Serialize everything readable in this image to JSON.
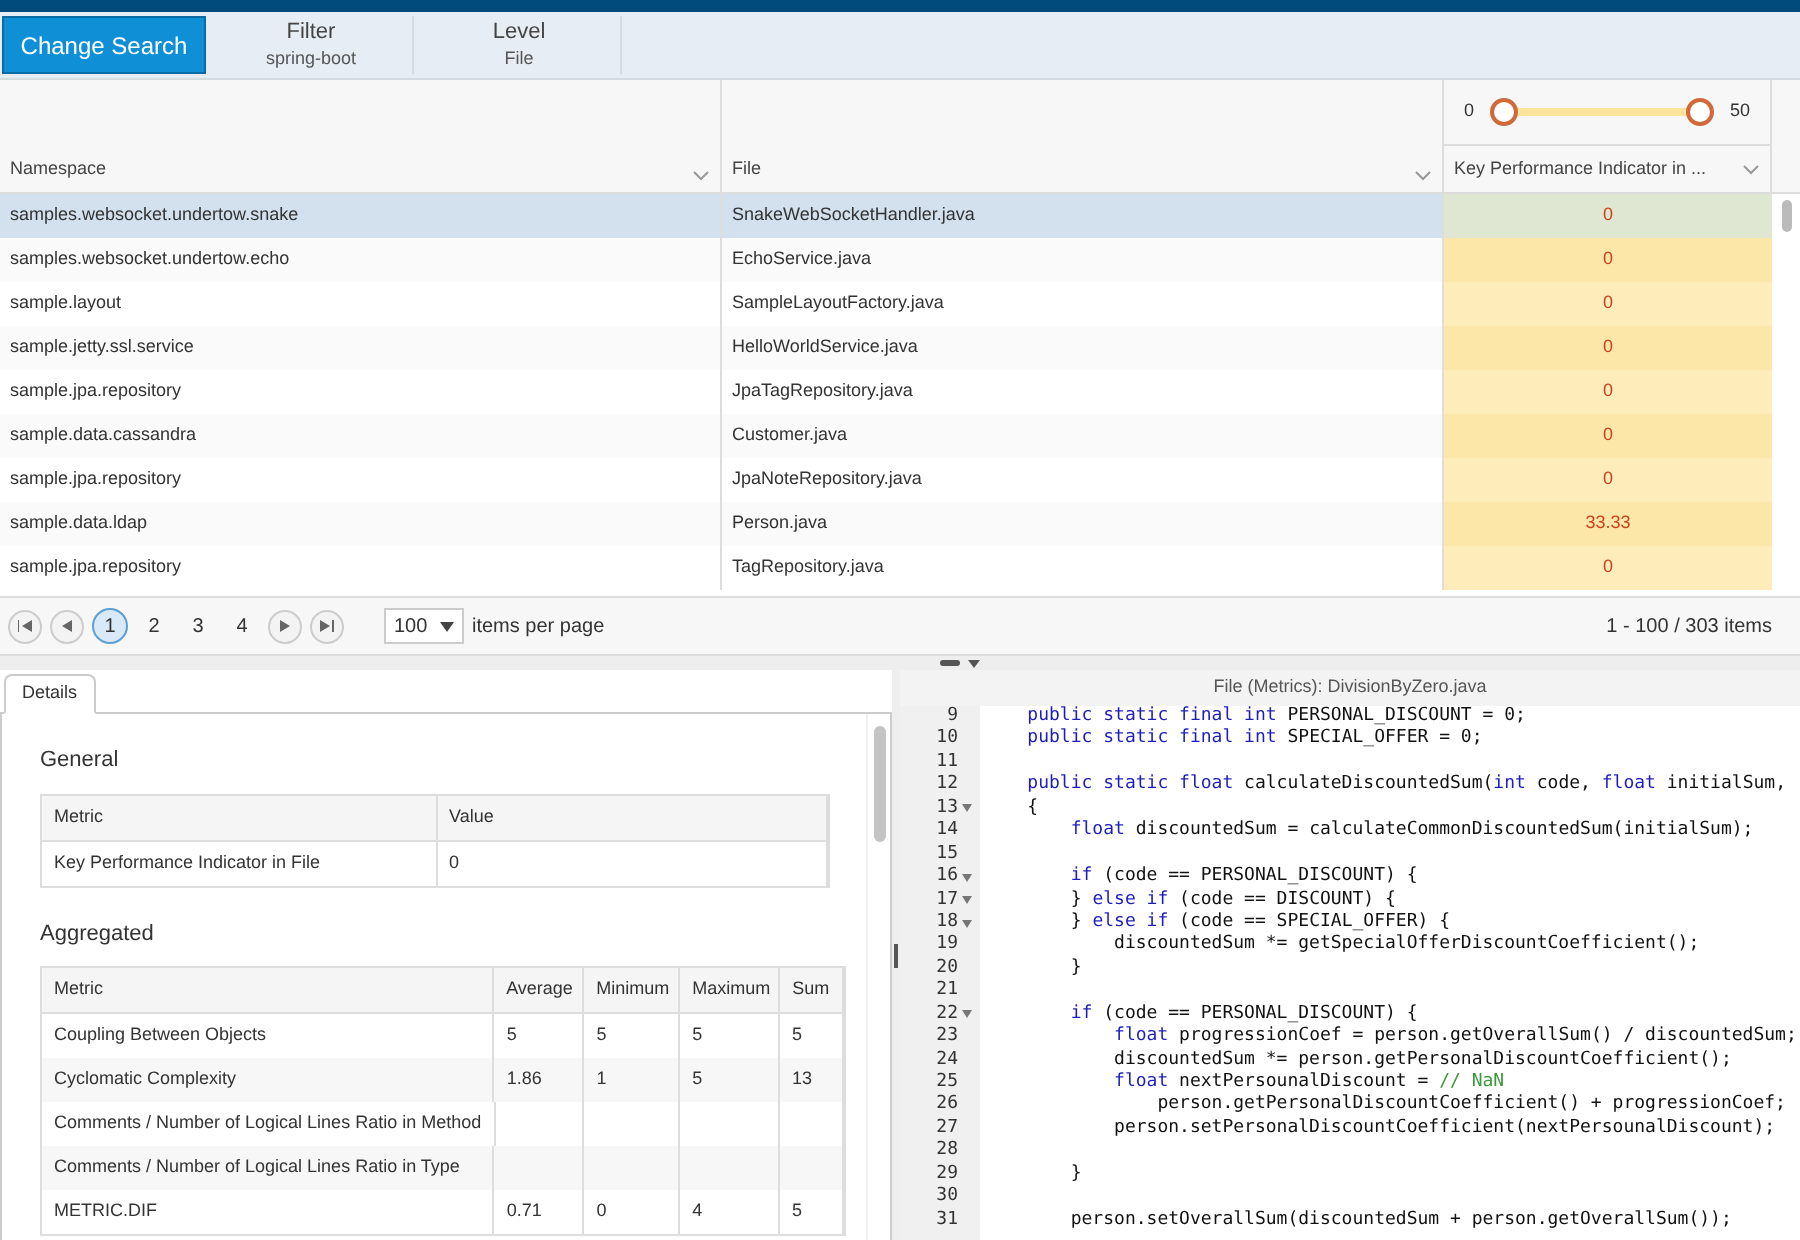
{
  "toolbar": {
    "button": "Change Search",
    "items": [
      {
        "label": "Filter",
        "value": "spring-boot"
      },
      {
        "label": "Level",
        "value": "File"
      }
    ]
  },
  "grid": {
    "columns": [
      "Namespace",
      "File",
      "Key Performance Indicator in ..."
    ],
    "range_slider": {
      "min_label": "0",
      "max_label": "50",
      "level": 1
    },
    "rows": [
      {
        "namespace": "samples.websocket.undertow.snake",
        "file": "SnakeWebSocketHandler.java",
        "kpi": "0",
        "selected": true
      },
      {
        "namespace": "samples.websocket.undertow.echo",
        "file": "EchoService.java",
        "kpi": "0",
        "selected": false
      },
      {
        "namespace": "sample.layout",
        "file": "SampleLayoutFactory.java",
        "kpi": "0",
        "selected": false
      },
      {
        "namespace": "sample.jetty.ssl.service",
        "file": "HelloWorldService.java",
        "kpi": "0",
        "selected": false
      },
      {
        "namespace": "sample.jpa.repository",
        "file": "JpaTagRepository.java",
        "kpi": "0",
        "selected": false
      },
      {
        "namespace": "sample.data.cassandra",
        "file": "Customer.java",
        "kpi": "0",
        "selected": false
      },
      {
        "namespace": "sample.jpa.repository",
        "file": "JpaNoteRepository.java",
        "kpi": "0",
        "selected": false
      },
      {
        "namespace": "sample.data.ldap",
        "file": "Person.java",
        "kpi": "33.33",
        "selected": false
      },
      {
        "namespace": "sample.jpa.repository",
        "file": "TagRepository.java",
        "kpi": "0",
        "selected": false
      }
    ]
  },
  "pager": {
    "pages": [
      {
        "label": "1",
        "selected": true
      },
      {
        "label": "2",
        "selected": false
      },
      {
        "label": "3",
        "selected": false
      },
      {
        "label": "4",
        "selected": false
      }
    ],
    "page_size": "100",
    "page_size_label": "items per page",
    "summary": "1 - 100 / 303 items"
  },
  "details": {
    "tabs": [
      {
        "label": "Details",
        "selected": true
      }
    ],
    "general": {
      "title": "General",
      "columns": [
        "Metric",
        "Value"
      ],
      "rows": [
        [
          "Key Performance Indicator in File",
          "0"
        ]
      ]
    },
    "aggregated": {
      "title": "Aggregated",
      "columns": [
        "Metric",
        "Average",
        "Minimum",
        "Maximum",
        "Sum"
      ],
      "rows": [
        [
          "Coupling Between Objects",
          "5",
          "5",
          "5",
          "5"
        ],
        [
          "Cyclomatic Complexity",
          "1.86",
          "1",
          "5",
          "13"
        ],
        [
          "Comments / Number of Logical Lines Ratio in Method",
          null,
          null,
          null,
          null
        ],
        [
          "Comments / Number of Logical Lines Ratio in Type",
          null,
          null,
          null,
          null
        ],
        [
          "METRIC.DIF",
          "0.71",
          "0",
          "4",
          "5"
        ]
      ]
    }
  },
  "editor": {
    "title": "File (Metrics): DivisionByZero.java",
    "lines": [
      {
        "number": "9",
        "fold": false,
        "tokens": [
          {
            "kind": "keyword",
            "text": "    public static final int"
          },
          {
            "kind": "plain",
            "text": " PERSONAL_DISCOUNT = 0;"
          }
        ]
      },
      {
        "number": "10",
        "fold": false,
        "tokens": [
          {
            "kind": "keyword",
            "text": "    public static final int"
          },
          {
            "kind": "plain",
            "text": " SPECIAL_OFFER = 0;"
          }
        ]
      },
      {
        "number": "11",
        "fold": false
      },
      {
        "number": "12",
        "fold": false,
        "tokens": [
          {
            "kind": "keyword",
            "text": "    public static float"
          },
          {
            "kind": "plain",
            "text": " calculateDiscountedSum("
          },
          {
            "kind": "keyword",
            "text": "int"
          },
          {
            "kind": "plain",
            "text": " code, "
          },
          {
            "kind": "keyword",
            "text": "float"
          },
          {
            "kind": "plain",
            "text": " initialSum,"
          }
        ]
      },
      {
        "number": "13",
        "fold": true,
        "tokens": [
          {
            "kind": "plain",
            "text": "    {"
          }
        ]
      },
      {
        "number": "14",
        "fold": false,
        "tokens": [
          {
            "kind": "keyword",
            "text": "        float"
          },
          {
            "kind": "plain",
            "text": " discountedSum = calculateCommonDiscountedSum(initialSum);"
          }
        ]
      },
      {
        "number": "15",
        "fold": false
      },
      {
        "number": "16",
        "fold": true,
        "tokens": [
          {
            "kind": "keyword",
            "text": "        if"
          },
          {
            "kind": "plain",
            "text": " (code == PERSONAL_DISCOUNT) {"
          }
        ]
      },
      {
        "number": "17",
        "fold": true,
        "tokens": [
          {
            "kind": "plain",
            "text": "        } "
          },
          {
            "kind": "keyword",
            "text": "else if"
          },
          {
            "kind": "plain",
            "text": " (code == DISCOUNT) {"
          }
        ]
      },
      {
        "number": "18",
        "fold": true,
        "tokens": [
          {
            "kind": "plain",
            "text": "        } "
          },
          {
            "kind": "keyword",
            "text": "else if"
          },
          {
            "kind": "plain",
            "text": " (code == SPECIAL_OFFER) {"
          }
        ]
      },
      {
        "number": "19",
        "fold": false,
        "tokens": [
          {
            "kind": "plain",
            "text": "            discountedSum *= getSpecialOfferDiscountCoefficient();"
          }
        ]
      },
      {
        "number": "20",
        "fold": false,
        "tokens": [
          {
            "kind": "plain",
            "text": "        }"
          }
        ]
      },
      {
        "number": "21",
        "fold": false
      },
      {
        "number": "22",
        "fold": true,
        "tokens": [
          {
            "kind": "keyword",
            "text": "        if"
          },
          {
            "kind": "plain",
            "text": " (code == PERSONAL_DISCOUNT) {"
          }
        ]
      },
      {
        "number": "23",
        "fold": false,
        "tokens": [
          {
            "kind": "keyword",
            "text": "            float"
          },
          {
            "kind": "plain",
            "text": " progressionCoef = person.getOverallSum() / discountedSum;"
          }
        ]
      },
      {
        "number": "24",
        "fold": false,
        "tokens": [
          {
            "kind": "plain",
            "text": "            discountedSum *= person.getPersonalDiscountCoefficient();"
          }
        ]
      },
      {
        "number": "25",
        "fold": false,
        "tokens": [
          {
            "kind": "keyword",
            "text": "            float"
          },
          {
            "kind": "plain",
            "text": " nextPersounalDiscount = "
          },
          {
            "kind": "comment",
            "text": "// NaN"
          }
        ]
      },
      {
        "number": "26",
        "fold": false,
        "tokens": [
          {
            "kind": "plain",
            "text": "                person.getPersonalDiscountCoefficient() + progressionCoef;"
          }
        ]
      },
      {
        "number": "27",
        "fold": false,
        "tokens": [
          {
            "kind": "plain",
            "text": "            person.setPersonalDiscountCoefficient(nextPersounalDiscount);"
          }
        ]
      },
      {
        "number": "28",
        "fold": false
      },
      {
        "number": "29",
        "fold": false,
        "tokens": [
          {
            "kind": "plain",
            "text": "        }"
          }
        ]
      },
      {
        "number": "30",
        "fold": false
      },
      {
        "number": "31",
        "fold": false,
        "tokens": [
          {
            "kind": "plain",
            "text": "        person.setOverallSum(discountedSum + person.getOverallSum());"
          }
        ]
      }
    ]
  }
}
